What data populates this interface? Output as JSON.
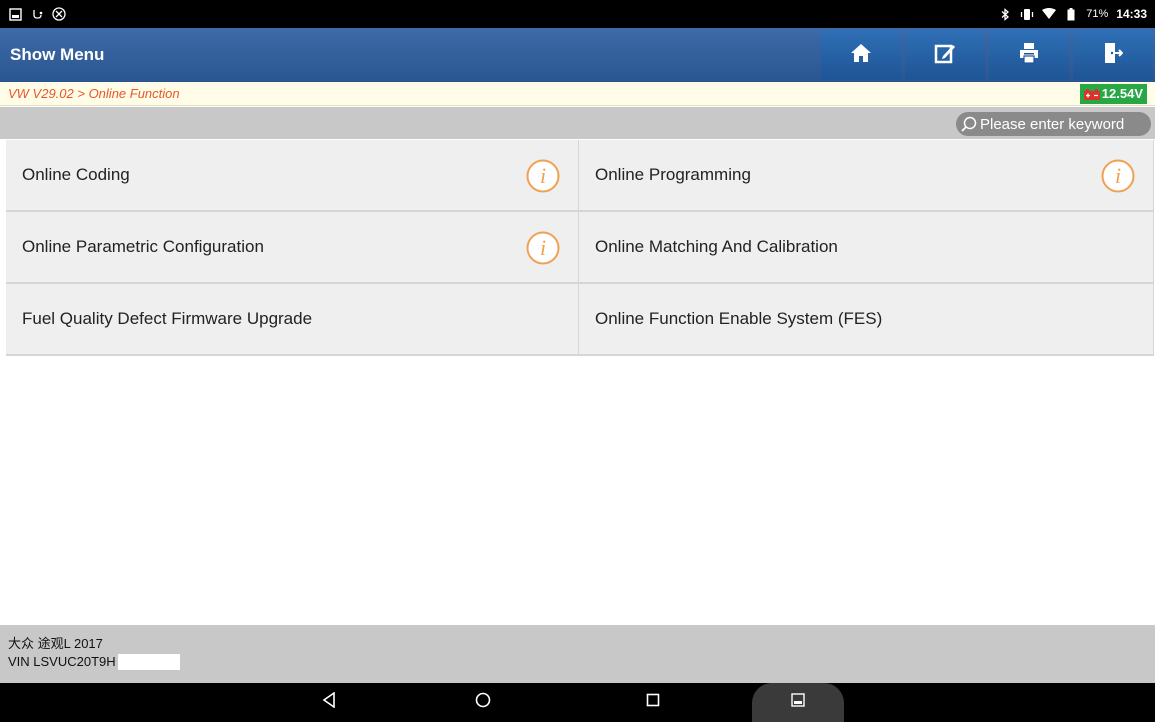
{
  "status_bar": {
    "left_icons": [
      "gallery-icon",
      "usb-debug-icon",
      "vibrate-off-icon"
    ],
    "right_icons": [
      "bluetooth-icon",
      "vibrate-icon",
      "wifi-icon",
      "battery-icon"
    ],
    "battery_percent": "71%",
    "time": "14:33"
  },
  "header": {
    "title": "Show Menu",
    "buttons": [
      {
        "icon": "home-icon"
      },
      {
        "icon": "edit-icon"
      },
      {
        "icon": "print-icon"
      },
      {
        "icon": "exit-icon"
      }
    ]
  },
  "breadcrumb": {
    "path": "VW V29.02 > Online Function",
    "voltage": "12.54V"
  },
  "search": {
    "placeholder": "Please enter keyword"
  },
  "menu": {
    "items": [
      {
        "label": "Online Coding",
        "has_info": true
      },
      {
        "label": "Online Programming",
        "has_info": true
      },
      {
        "label": "Online Parametric Configuration",
        "has_info": true
      },
      {
        "label": "Online Matching And Calibration",
        "has_info": false
      },
      {
        "label": "Fuel Quality Defect Firmware Upgrade",
        "has_info": false
      },
      {
        "label": "Online Function Enable System (FES)",
        "has_info": false
      }
    ]
  },
  "footer": {
    "vehicle": "大众 途观L 2017",
    "vin": "VIN LSVUC20T9H"
  },
  "colors": {
    "header_blue": "#2a5590",
    "breadcrumb_orange": "#e8552a",
    "voltage_green": "#28a745",
    "info_orange": "#f0a050"
  }
}
